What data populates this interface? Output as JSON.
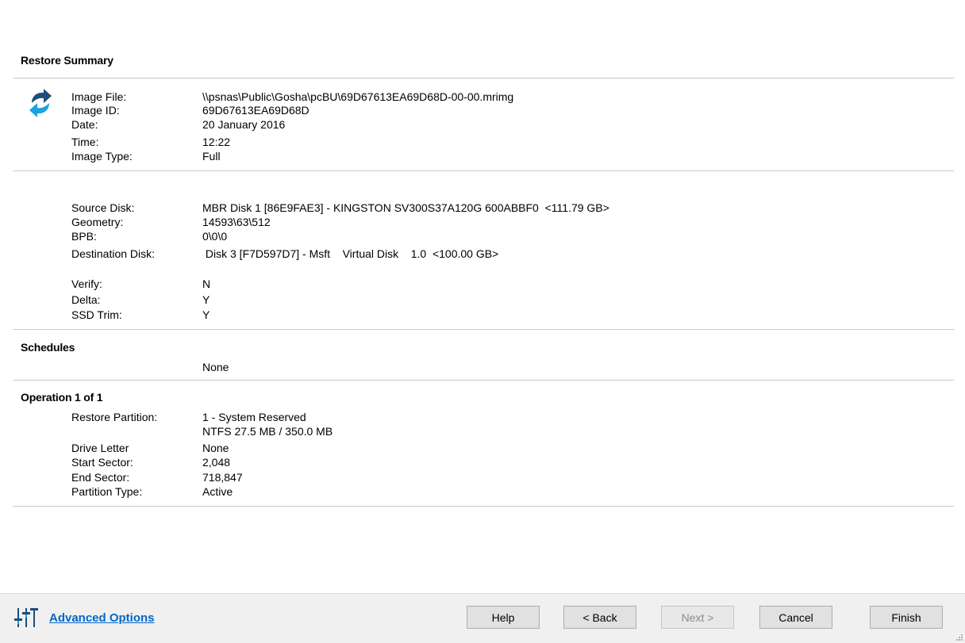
{
  "summary": {
    "title": "Restore Summary",
    "image": [
      {
        "label": "Image File:",
        "value": "\\\\psnas\\Public\\Gosha\\pcBU\\69D67613EA69D68D-00-00.mrimg"
      },
      {
        "label": "Image ID:",
        "value": "69D67613EA69D68D"
      },
      {
        "label": "Date:",
        "value": "20 January 2016"
      },
      {
        "label": "Time:",
        "value": "12:22"
      },
      {
        "label": "Image Type:",
        "value": "Full"
      }
    ],
    "disk": [
      {
        "label": "Source Disk:",
        "value": "MBR Disk 1 [86E9FAE3] - KINGSTON SV300S37A120G 600ABBF0  <111.79 GB>"
      },
      {
        "label": "Geometry:",
        "value": "14593\\63\\512"
      },
      {
        "label": "BPB:",
        "value": "0\\0\\0"
      },
      {
        "label": "Destination Disk:",
        "value": " Disk 3 [F7D597D7] - Msft    Virtual Disk    1.0  <100.00 GB>"
      }
    ],
    "options": [
      {
        "label": "Verify:",
        "value": "N"
      },
      {
        "label": "Delta:",
        "value": "Y"
      },
      {
        "label": "SSD Trim:",
        "value": "Y"
      }
    ]
  },
  "schedules": {
    "title": "Schedules",
    "value": "None"
  },
  "operation": {
    "title": "Operation 1 of 1",
    "restore_partition_label": "Restore Partition:",
    "restore_partition_value": "1 - System Reserved",
    "restore_partition_detail": "NTFS 27.5 MB / 350.0 MB",
    "rows": [
      {
        "label": "Drive Letter",
        "value": "None"
      },
      {
        "label": "Start Sector:",
        "value": "2,048"
      },
      {
        "label": "End Sector:",
        "value": "718,847"
      },
      {
        "label": "Partition Type:",
        "value": "Active"
      }
    ]
  },
  "footer": {
    "advanced_options": "Advanced Options",
    "help": "Help",
    "back": "< Back",
    "next": "Next >",
    "cancel": "Cancel",
    "finish": "Finish"
  },
  "icons": {
    "restore": "restore-arrows-icon",
    "advanced": "sliders-icon"
  },
  "colors": {
    "link": "#0066cc",
    "icon_dark": "#1f4e79",
    "icon_light": "#1ea1e0"
  }
}
